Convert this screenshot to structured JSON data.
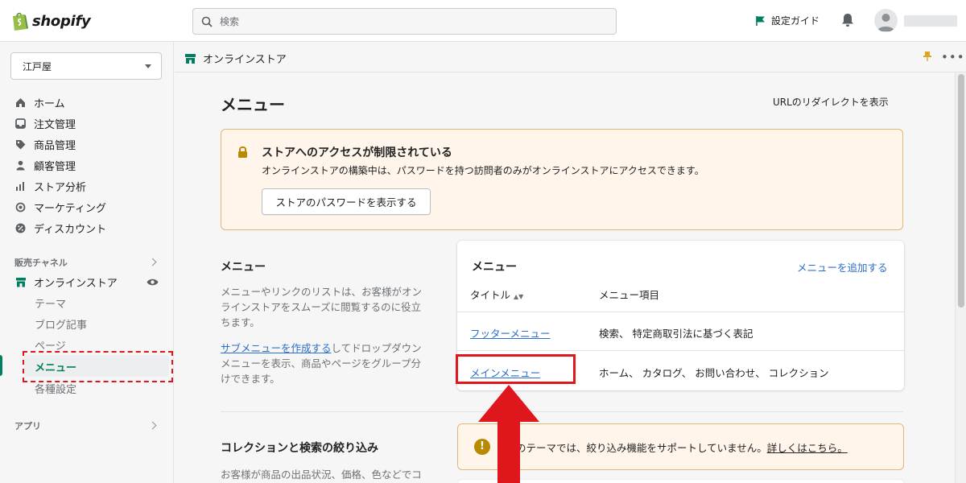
{
  "brand": {
    "logo_text": "shopify",
    "accent": "#008060",
    "link": "#2c6ecb",
    "highlight_red": "#e0161d"
  },
  "topbar": {
    "search_placeholder": "検索",
    "setup_guide": "設定ガイド"
  },
  "sidebar": {
    "store_name": "江戸屋",
    "items": [
      {
        "label": "ホーム",
        "icon": "home-icon"
      },
      {
        "label": "注文管理",
        "icon": "inbox-icon"
      },
      {
        "label": "商品管理",
        "icon": "tag-icon"
      },
      {
        "label": "顧客管理",
        "icon": "person-icon"
      },
      {
        "label": "ストア分析",
        "icon": "bar-chart-icon"
      },
      {
        "label": "マーケティング",
        "icon": "target-icon"
      },
      {
        "label": "ディスカウント",
        "icon": "discount-icon"
      }
    ],
    "sales_channels_heading": "販売チャネル",
    "online_store": "オンラインストア",
    "sub_items": [
      "テーマ",
      "ブログ記事",
      "ページ",
      "メニュー",
      "各種設定"
    ],
    "apps_heading": "アプリ"
  },
  "subheader": {
    "title": "オンラインストア"
  },
  "main": {
    "page_title": "メニュー",
    "url_redirect": "URLのリダイレクトを表示",
    "banner": {
      "title": "ストアへのアクセスが制限されている",
      "description": "オンラインストアの構築中は、パスワードを持つ訪問者のみがオンラインストアにアクセスできます。",
      "button": "ストアのパスワードを表示する"
    },
    "menu_section": {
      "title": "メニュー",
      "desc": "メニューやリンクのリストは、お客様がオンラインストアをスムーズに閲覧するのに役立ちます。",
      "link": "サブメニューを作成する",
      "desc2": "してドロップダウンメニューを表示、商品やページをグループ分けできます。"
    },
    "menu_card": {
      "title": "メニュー",
      "add_link": "メニューを追加する",
      "col_title": "タイトル",
      "col_items": "メニュー項目",
      "rows": [
        {
          "title": "フッターメニュー",
          "items": "検索、 特定商取引法に基づく表記"
        },
        {
          "title": "メインメニュー",
          "items": "ホーム、 カタログ、 お問い合わせ、 コレクション"
        }
      ]
    },
    "filter_section": {
      "title": "コレクションと検索の絞り込み",
      "desc": "お客様が商品の出品状況、価格、色などでコ",
      "notice": "のテーマでは、絞り込み機能をサポートしていません。",
      "notice_link": "詳しくはこちら。"
    }
  }
}
